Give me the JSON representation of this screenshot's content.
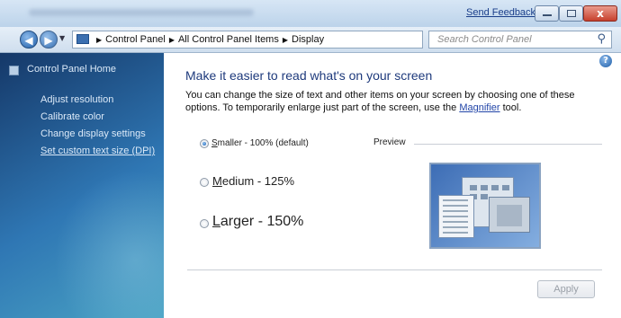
{
  "window": {
    "send_feedback": "Send Feedback",
    "close_glyph": "x"
  },
  "address_bar": {
    "crumbs": [
      "Control Panel",
      "All Control Panel Items",
      "Display"
    ],
    "search_placeholder": "Search Control Panel"
  },
  "sidebar": {
    "home": "Control Panel Home",
    "tasks": [
      {
        "label": "Adjust resolution"
      },
      {
        "label": "Calibrate color"
      },
      {
        "label": "Change display settings"
      },
      {
        "label": "Set custom text size (DPI)"
      }
    ]
  },
  "main": {
    "heading": "Make it easier to read what's on your screen",
    "description_before": "You can change the size of text and other items on your screen by choosing one of these options. To temporarily enlarge just part of the screen, use the ",
    "description_link": "Magnifier",
    "description_after": " tool.",
    "options": [
      {
        "first": "S",
        "rest": "maller - 100% (default)",
        "selected": true
      },
      {
        "first": "M",
        "rest": "edium - 125%",
        "selected": false
      },
      {
        "first": "L",
        "rest": "arger - 150%",
        "selected": false
      }
    ],
    "preview_label": "Preview",
    "apply_label": "Apply"
  },
  "colors": {
    "heading": "#1e3a7c",
    "link": "#2245a8",
    "sidebar_gradient_start": "#153868",
    "sidebar_gradient_end": "#4aa3c4"
  }
}
